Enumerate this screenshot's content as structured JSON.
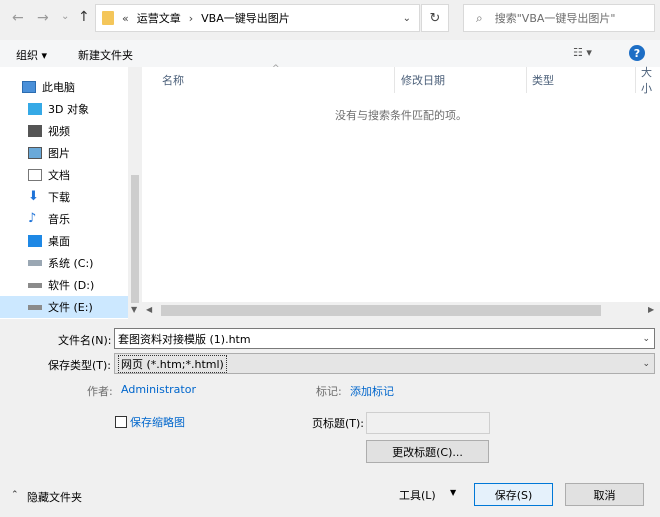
{
  "nav": {
    "back_icon": "arrow-left-icon",
    "forward_icon": "arrow-right-icon",
    "recent_icon": "chevron-down-icon",
    "up_icon": "arrow-up-icon"
  },
  "address": {
    "overflow": "«",
    "crumbs": [
      "运营文章",
      "VBA一键导出图片"
    ],
    "separator": "›"
  },
  "search": {
    "placeholder": "搜索\"VBA一键导出图片\""
  },
  "toolbar": {
    "organize": "组织 ▾",
    "new_folder": "新建文件夹"
  },
  "sidebar": {
    "items": [
      {
        "label": "此电脑",
        "icon": "pc-icon"
      },
      {
        "label": "3D 对象",
        "icon": "cube-icon"
      },
      {
        "label": "视频",
        "icon": "video-icon"
      },
      {
        "label": "图片",
        "icon": "picture-icon"
      },
      {
        "label": "文档",
        "icon": "document-icon"
      },
      {
        "label": "下载",
        "icon": "download-icon"
      },
      {
        "label": "音乐",
        "icon": "music-icon"
      },
      {
        "label": "桌面",
        "icon": "desktop-icon"
      },
      {
        "label": "系统 (C:)",
        "icon": "drive-icon"
      },
      {
        "label": "软件 (D:)",
        "icon": "drive-icon"
      },
      {
        "label": "文件 (E:)",
        "icon": "drive-icon"
      }
    ]
  },
  "list": {
    "columns": [
      "名称",
      "修改日期",
      "类型",
      "大小"
    ],
    "empty_message": "没有与搜索条件匹配的项。"
  },
  "form": {
    "filename_label": "文件名(N):",
    "filename_value": "套图资料对接模版 (1).htm",
    "filetype_label": "保存类型(T):",
    "filetype_value": "网页 (*.htm;*.html)",
    "author_label": "作者:",
    "author_value": "Administrator",
    "tags_label": "标记:",
    "tags_value": "添加标记",
    "thumbnail_label": "保存缩略图",
    "page_title_label": "页标题(T):",
    "page_title_value": "",
    "change_title_button": "更改标题(C)..."
  },
  "footer": {
    "hide_folders": "隐藏文件夹",
    "tools": "工具(L)",
    "save": "保存(S)",
    "cancel": "取消"
  }
}
